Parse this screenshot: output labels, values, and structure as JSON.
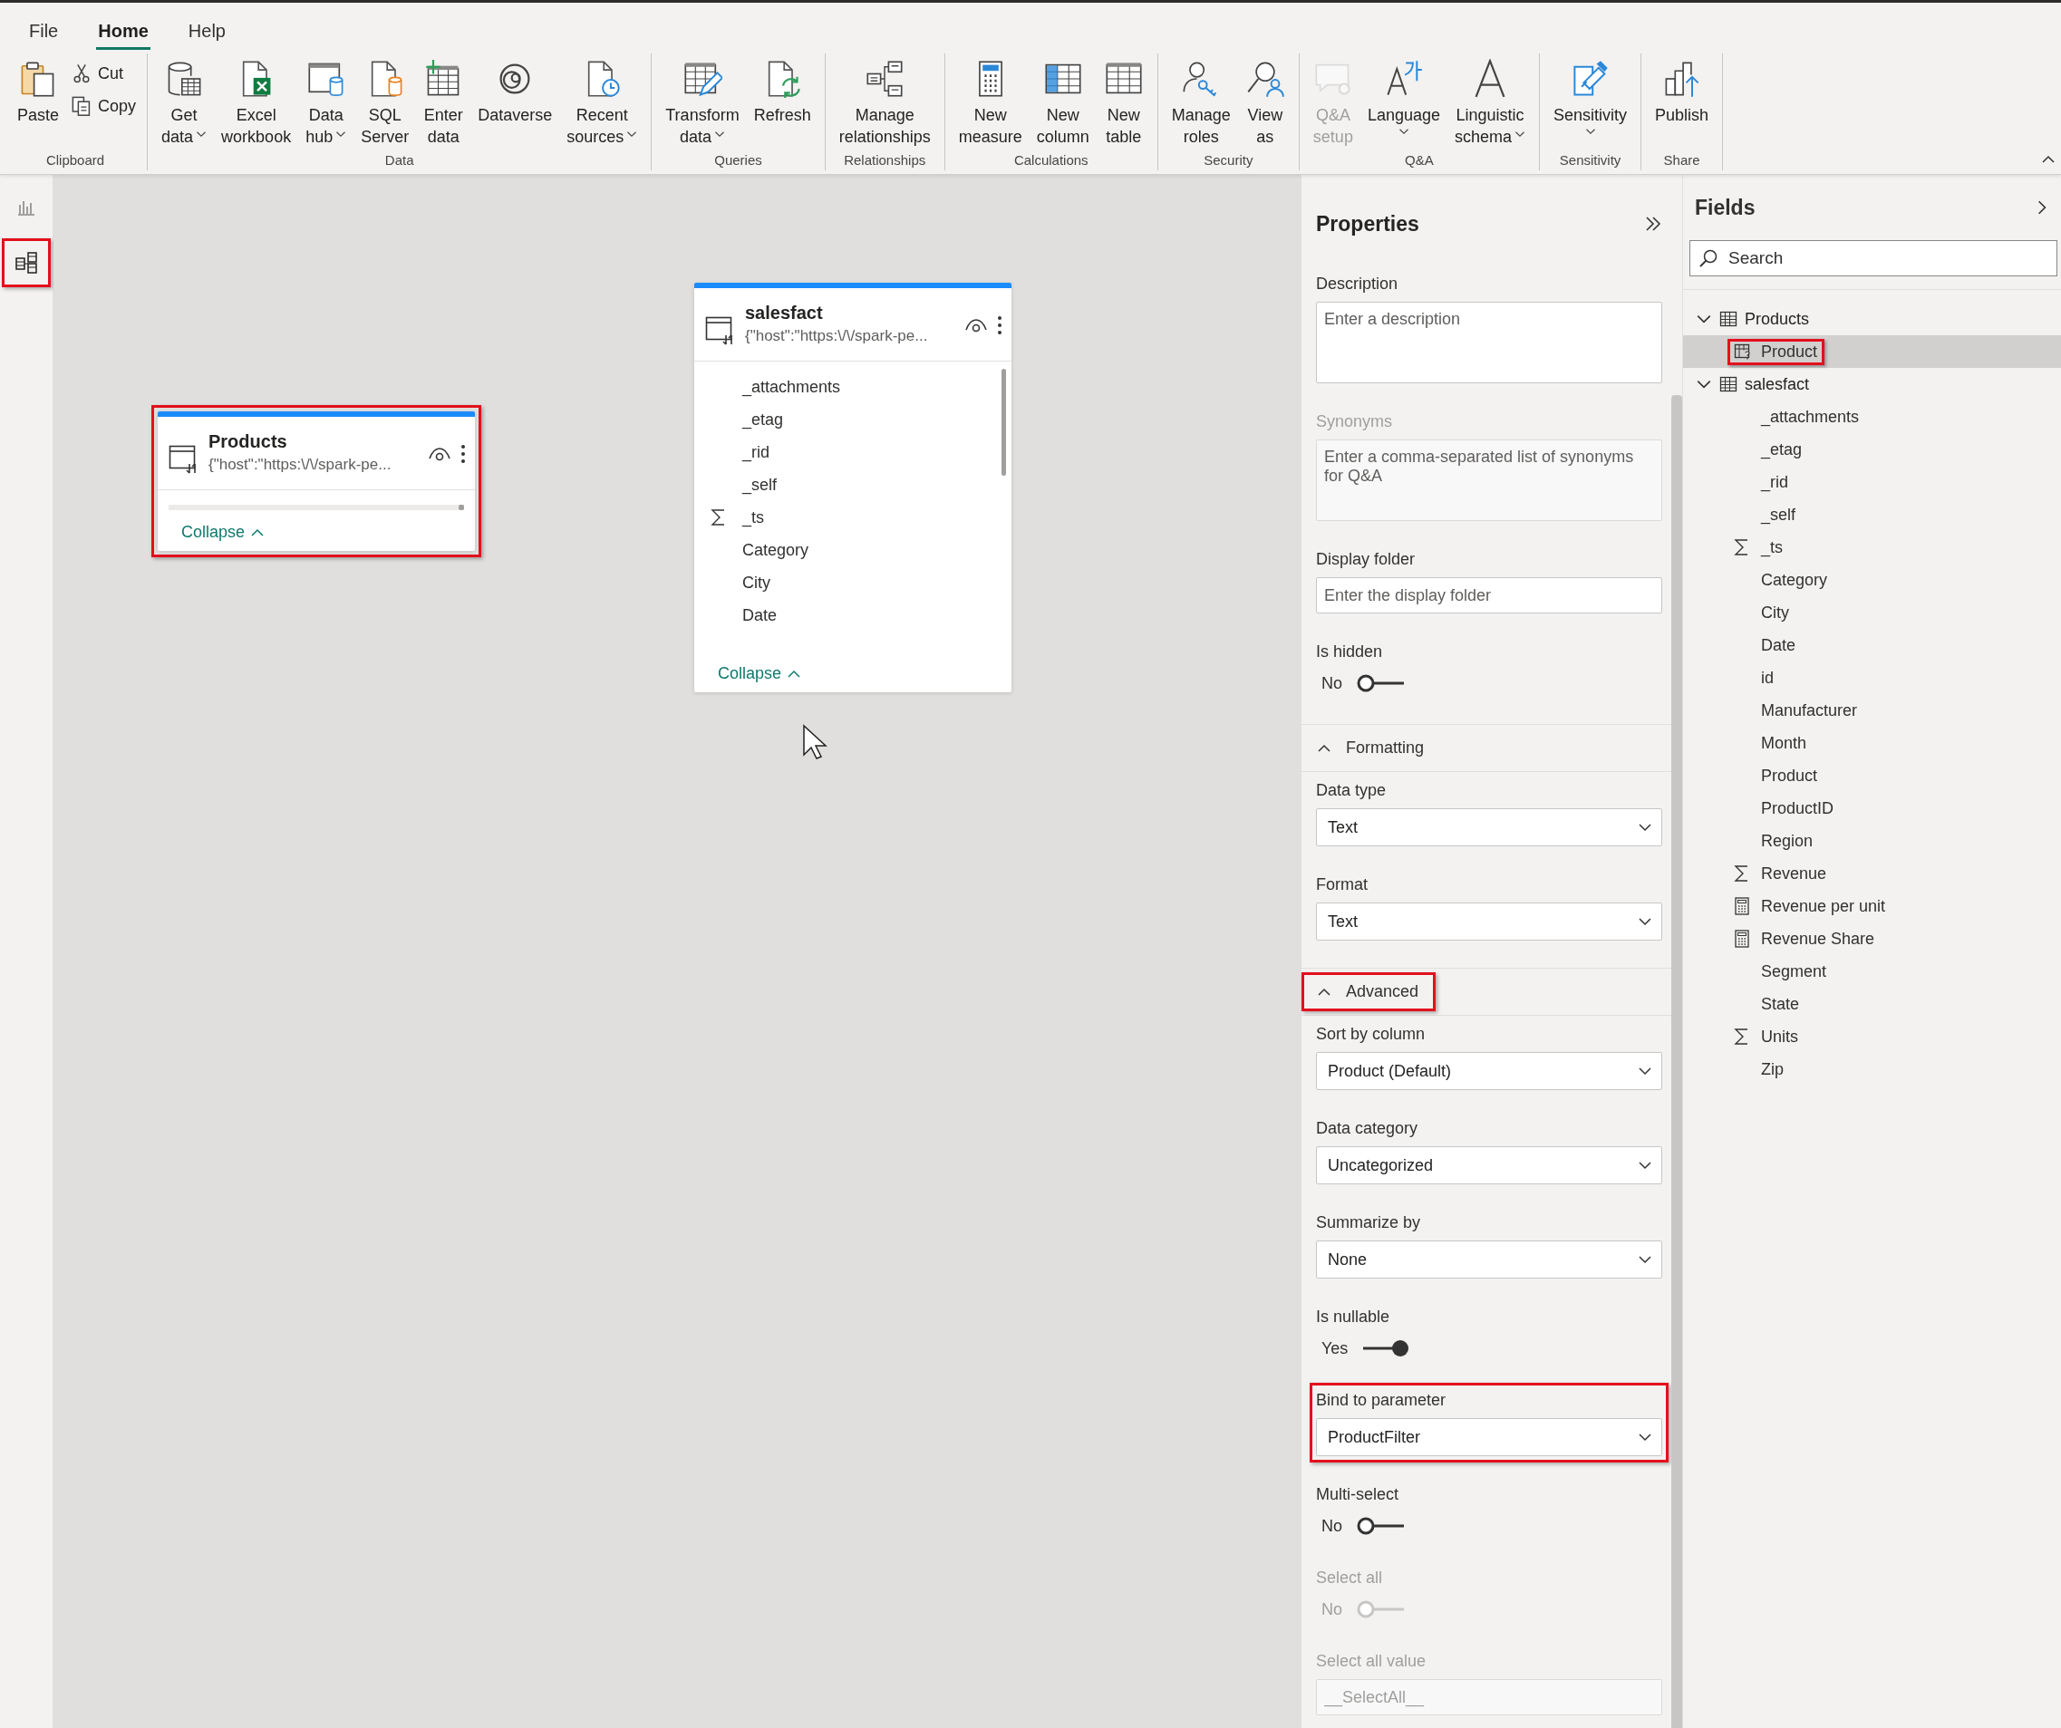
{
  "menu_tabs": [
    {
      "label": "File",
      "selected": false
    },
    {
      "label": "Home",
      "selected": true
    },
    {
      "label": "Help",
      "selected": false
    }
  ],
  "ribbon": {
    "groups": [
      {
        "label": "Clipboard",
        "buttons": [
          {
            "kind": "large",
            "lines": [
              "Paste"
            ],
            "dropdown": false,
            "disabled": false
          },
          {
            "kind": "small",
            "lines": [
              "Cut"
            ],
            "dropdown": false,
            "disabled": false
          },
          {
            "kind": "small",
            "lines": [
              "Copy"
            ],
            "dropdown": false,
            "disabled": false
          }
        ]
      },
      {
        "label": "Data",
        "buttons": [
          {
            "kind": "large",
            "lines": [
              "Get",
              "data"
            ],
            "dropdown": true,
            "disabled": false
          },
          {
            "kind": "large",
            "lines": [
              "Excel",
              "workbook"
            ],
            "dropdown": false,
            "disabled": false
          },
          {
            "kind": "large",
            "lines": [
              "Data",
              "hub"
            ],
            "dropdown": true,
            "disabled": false
          },
          {
            "kind": "large",
            "lines": [
              "SQL",
              "Server"
            ],
            "dropdown": false,
            "disabled": false
          },
          {
            "kind": "large",
            "lines": [
              "Enter",
              "data"
            ],
            "dropdown": false,
            "disabled": false
          },
          {
            "kind": "large",
            "lines": [
              "Dataverse"
            ],
            "dropdown": false,
            "disabled": false
          },
          {
            "kind": "large",
            "lines": [
              "Recent",
              "sources"
            ],
            "dropdown": true,
            "disabled": false
          }
        ]
      },
      {
        "label": "Queries",
        "buttons": [
          {
            "kind": "large",
            "lines": [
              "Transform",
              "data"
            ],
            "dropdown": true,
            "disabled": false
          },
          {
            "kind": "large",
            "lines": [
              "Refresh"
            ],
            "dropdown": false,
            "disabled": false
          }
        ]
      },
      {
        "label": "Relationships",
        "buttons": [
          {
            "kind": "large",
            "lines": [
              "Manage",
              "relationships"
            ],
            "dropdown": false,
            "disabled": false
          }
        ]
      },
      {
        "label": "Calculations",
        "buttons": [
          {
            "kind": "large",
            "lines": [
              "New",
              "measure"
            ],
            "dropdown": false,
            "disabled": false
          },
          {
            "kind": "large",
            "lines": [
              "New",
              "column"
            ],
            "dropdown": false,
            "disabled": false
          },
          {
            "kind": "large",
            "lines": [
              "New",
              "table"
            ],
            "dropdown": false,
            "disabled": false
          }
        ]
      },
      {
        "label": "Security",
        "buttons": [
          {
            "kind": "large",
            "lines": [
              "Manage",
              "roles"
            ],
            "dropdown": false,
            "disabled": false
          },
          {
            "kind": "large",
            "lines": [
              "View",
              "as"
            ],
            "dropdown": false,
            "disabled": false
          }
        ]
      },
      {
        "label": "Q&A",
        "buttons": [
          {
            "kind": "large",
            "lines": [
              "Q&A",
              "setup"
            ],
            "dropdown": false,
            "disabled": true
          },
          {
            "kind": "large",
            "lines": [
              "Language"
            ],
            "dropdown": true,
            "disabled": false
          },
          {
            "kind": "large",
            "lines": [
              "Linguistic",
              "schema"
            ],
            "dropdown": true,
            "disabled": false
          }
        ]
      },
      {
        "label": "Sensitivity",
        "buttons": [
          {
            "kind": "large",
            "lines": [
              "Sensitivity"
            ],
            "dropdown": true,
            "disabled": false
          }
        ]
      },
      {
        "label": "Share",
        "buttons": [
          {
            "kind": "large",
            "lines": [
              "Publish"
            ],
            "dropdown": false,
            "disabled": false
          }
        ]
      }
    ]
  },
  "view_rail": [
    {
      "selected": false,
      "highlighted": false
    },
    {
      "selected": true,
      "highlighted": true
    }
  ],
  "canvas": {
    "tables": [
      {
        "name": "Products",
        "source": "{\"host\":\"https:\\/\\/spark-pe...",
        "highlighted": true,
        "collapse_label": "Collapse"
      },
      {
        "name": "salesfact",
        "source": "{\"host\":\"https:\\/\\/spark-pe...",
        "highlighted": false,
        "fields": [
          {
            "name": "_attachments",
            "kind": "column"
          },
          {
            "name": "_etag",
            "kind": "column"
          },
          {
            "name": "_rid",
            "kind": "column"
          },
          {
            "name": "_self",
            "kind": "column"
          },
          {
            "name": "_ts",
            "kind": "sum"
          },
          {
            "name": "Category",
            "kind": "column"
          },
          {
            "name": "City",
            "kind": "column"
          },
          {
            "name": "Date",
            "kind": "column"
          }
        ],
        "collapse_label": "Collapse"
      }
    ]
  },
  "properties": {
    "title": "Properties",
    "items": [
      {
        "kind": "textarea",
        "label": "Description",
        "placeholder": "Enter a description",
        "disabled": false,
        "highlighted": false
      },
      {
        "kind": "textarea",
        "label": "Synonyms",
        "placeholder": "Enter a comma-separated list of synonyms for Q&A",
        "disabled": true,
        "highlighted": false
      },
      {
        "kind": "input",
        "label": "Display folder",
        "placeholder": "Enter the display folder",
        "disabled": false,
        "highlighted": false
      },
      {
        "kind": "toggle",
        "label": "Is hidden",
        "value": "No",
        "on": false,
        "disabled": false,
        "highlighted": false
      },
      {
        "kind": "section",
        "title": "Formatting",
        "expanded": true,
        "highlighted": false
      },
      {
        "kind": "select",
        "label": "Data type",
        "value": "Text",
        "disabled": false,
        "highlighted": false
      },
      {
        "kind": "select",
        "label": "Format",
        "value": "Text",
        "disabled": false,
        "highlighted": false
      },
      {
        "kind": "section",
        "title": "Advanced",
        "expanded": true,
        "highlighted": true
      },
      {
        "kind": "select",
        "label": "Sort by column",
        "value": "Product (Default)",
        "disabled": false,
        "highlighted": false
      },
      {
        "kind": "select",
        "label": "Data category",
        "value": "Uncategorized",
        "disabled": false,
        "highlighted": false
      },
      {
        "kind": "select",
        "label": "Summarize by",
        "value": "None",
        "disabled": false,
        "highlighted": false
      },
      {
        "kind": "toggle",
        "label": "Is nullable",
        "value": "Yes",
        "on": true,
        "disabled": false,
        "highlighted": false
      },
      {
        "kind": "select",
        "label": "Bind to parameter",
        "value": "ProductFilter",
        "disabled": false,
        "highlighted": true
      },
      {
        "kind": "toggle",
        "label": "Multi-select",
        "value": "No",
        "on": false,
        "disabled": false,
        "highlighted": false
      },
      {
        "kind": "toggle",
        "label": "Select all",
        "value": "No",
        "on": false,
        "disabled": true,
        "highlighted": false
      },
      {
        "kind": "input",
        "label": "Select all value",
        "placeholder": "__SelectAll__",
        "disabled": true,
        "highlighted": false
      }
    ]
  },
  "fields": {
    "title": "Fields",
    "search": {
      "placeholder": "Search"
    },
    "tables": [
      {
        "name": "Products",
        "expanded": true,
        "children": [
          {
            "name": "Product",
            "kind": "parameter",
            "selected": true,
            "highlighted": true
          }
        ]
      },
      {
        "name": "salesfact",
        "expanded": true,
        "children": [
          {
            "name": "_attachments",
            "kind": "column",
            "selected": false,
            "highlighted": false
          },
          {
            "name": "_etag",
            "kind": "column",
            "selected": false,
            "highlighted": false
          },
          {
            "name": "_rid",
            "kind": "column",
            "selected": false,
            "highlighted": false
          },
          {
            "name": "_self",
            "kind": "column",
            "selected": false,
            "highlighted": false
          },
          {
            "name": "_ts",
            "kind": "sum",
            "selected": false,
            "highlighted": false
          },
          {
            "name": "Category",
            "kind": "column",
            "selected": false,
            "highlighted": false
          },
          {
            "name": "City",
            "kind": "column",
            "selected": false,
            "highlighted": false
          },
          {
            "name": "Date",
            "kind": "column",
            "selected": false,
            "highlighted": false
          },
          {
            "name": "id",
            "kind": "column",
            "selected": false,
            "highlighted": false
          },
          {
            "name": "Manufacturer",
            "kind": "column",
            "selected": false,
            "highlighted": false
          },
          {
            "name": "Month",
            "kind": "column",
            "selected": false,
            "highlighted": false
          },
          {
            "name": "Product",
            "kind": "column",
            "selected": false,
            "highlighted": false
          },
          {
            "name": "ProductID",
            "kind": "column",
            "selected": false,
            "highlighted": false
          },
          {
            "name": "Region",
            "kind": "column",
            "selected": false,
            "highlighted": false
          },
          {
            "name": "Revenue",
            "kind": "sum",
            "selected": false,
            "highlighted": false
          },
          {
            "name": "Revenue per unit",
            "kind": "calc",
            "selected": false,
            "highlighted": false
          },
          {
            "name": "Revenue Share",
            "kind": "calc",
            "selected": false,
            "highlighted": false
          },
          {
            "name": "Segment",
            "kind": "column",
            "selected": false,
            "highlighted": false
          },
          {
            "name": "State",
            "kind": "column",
            "selected": false,
            "highlighted": false
          },
          {
            "name": "Units",
            "kind": "sum",
            "selected": false,
            "highlighted": false
          },
          {
            "name": "Zip",
            "kind": "column",
            "selected": false,
            "highlighted": false
          }
        ]
      }
    ]
  }
}
